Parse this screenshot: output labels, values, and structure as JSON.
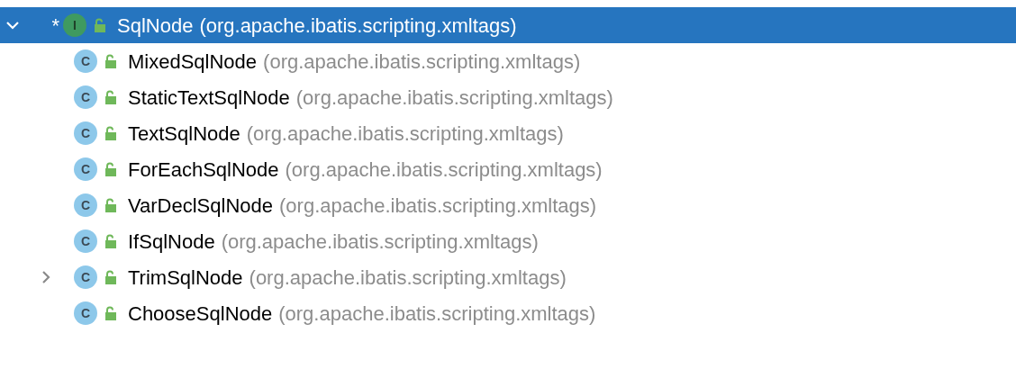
{
  "tree": [
    {
      "marker": "*",
      "icon_letter": "I",
      "name": "SqlNode",
      "package": "(org.apache.ibatis.scripting.xmltags)",
      "selected": true,
      "expanded": true,
      "children": [
        {
          "icon_letter": "C",
          "name": "MixedSqlNode",
          "package": "(org.apache.ibatis.scripting.xmltags)",
          "selected": false
        },
        {
          "icon_letter": "C",
          "name": "StaticTextSqlNode",
          "package": "(org.apache.ibatis.scripting.xmltags)",
          "selected": false
        },
        {
          "icon_letter": "C",
          "name": "TextSqlNode",
          "package": "(org.apache.ibatis.scripting.xmltags)",
          "selected": false
        },
        {
          "icon_letter": "C",
          "name": "ForEachSqlNode",
          "package": "(org.apache.ibatis.scripting.xmltags)",
          "selected": false
        },
        {
          "icon_letter": "C",
          "name": "VarDeclSqlNode",
          "package": "(org.apache.ibatis.scripting.xmltags)",
          "selected": false
        },
        {
          "icon_letter": "C",
          "name": "IfSqlNode",
          "package": "(org.apache.ibatis.scripting.xmltags)",
          "selected": false
        },
        {
          "icon_letter": "C",
          "name": "TrimSqlNode",
          "package": "(org.apache.ibatis.scripting.xmltags)",
          "selected": false,
          "expanded": false
        },
        {
          "icon_letter": "C",
          "name": "ChooseSqlNode",
          "package": "(org.apache.ibatis.scripting.xmltags)",
          "selected": false
        }
      ]
    }
  ]
}
